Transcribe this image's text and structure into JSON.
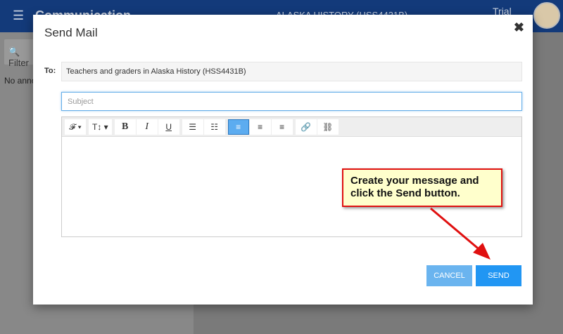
{
  "header": {
    "menu_icon": "menu-icon",
    "app_title": "Communication",
    "course": "ALASKA HISTORY (HSS4431B)",
    "user_label": "Trial"
  },
  "sidebar": {
    "filter_placeholder": "Filter",
    "empty_text": "No announcements"
  },
  "modal": {
    "title": "Send Mail",
    "close_label": "✖",
    "to_label": "To:",
    "to_value": "Teachers and graders in Alaska History (HSS4431B)",
    "subject_placeholder": "Subject",
    "toolbar": {
      "font": "𝓕 ▾",
      "size": "T↕ ▾",
      "bold": "B",
      "italic": "I",
      "underline": "U",
      "bullets": "☰",
      "numbered": "☷",
      "align_left": "≡",
      "align_center": "≡",
      "align_right": "≡",
      "link": "🔗",
      "unlink": "⛓"
    },
    "cancel_label": "CANCEL",
    "send_label": "SEND"
  },
  "callout": {
    "text": "Create your message and click the Send button."
  }
}
